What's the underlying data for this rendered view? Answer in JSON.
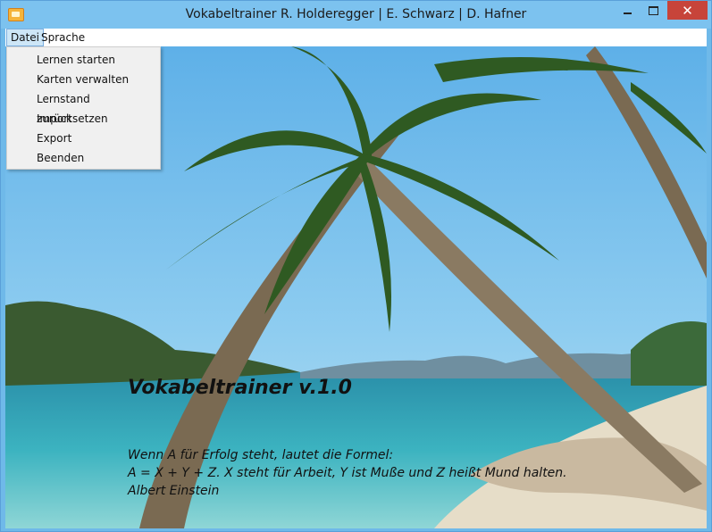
{
  "window": {
    "title": "Vokabeltrainer R. Holderegger | E. Schwarz | D. Hafner"
  },
  "controls": {
    "minimize": "minimize-icon",
    "maximize": "maximize-icon",
    "close": "close-icon"
  },
  "menubar": {
    "items": [
      "Datei",
      "Sprache"
    ]
  },
  "datei_menu": {
    "items": [
      "Lernen starten",
      "Karten verwalten",
      "Lernstand zurücksetzen",
      "Import",
      "Export",
      "Beenden"
    ]
  },
  "main": {
    "heading": "Vokabeltrainer v.1.0",
    "quote_lines": [
      "Wenn A für Erfolg steht, lautet die Formel:",
      "A = X + Y + Z. X steht für Arbeit, Y ist Muße und Z heißt Mund halten.",
      "Albert Einstein"
    ]
  },
  "colors": {
    "titlebar": "#7cc2ef",
    "close": "#c7443a",
    "menu_highlight": "#cde6f7"
  }
}
